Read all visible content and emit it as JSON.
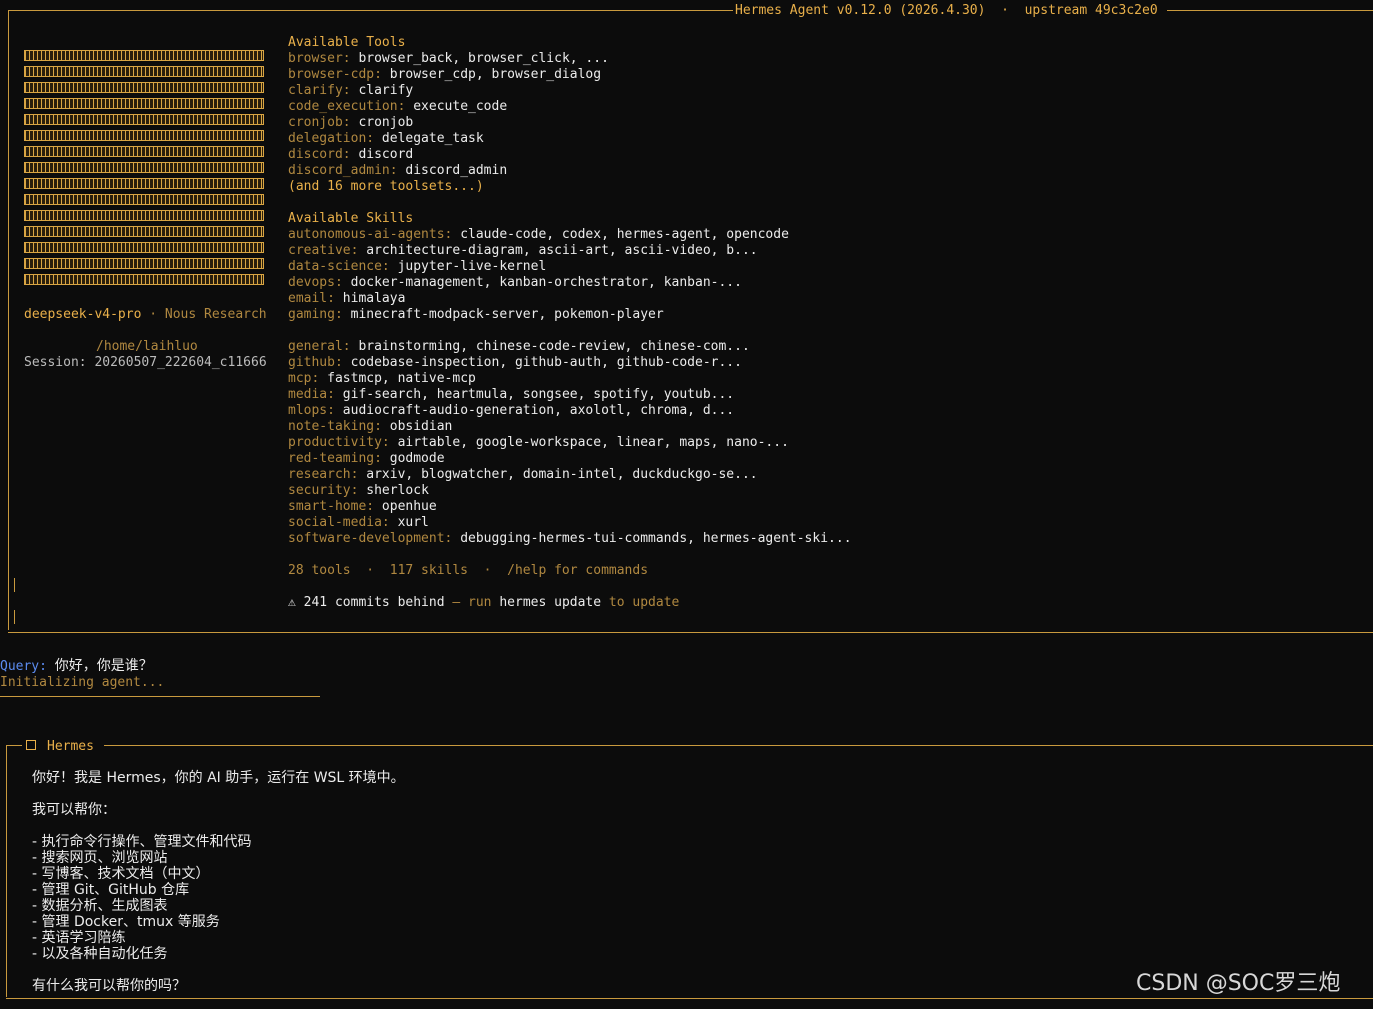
{
  "banner": {
    "title": "Hermes Agent v0.12.0 (2026.4.30)  ·  upstream 49c3c2e0",
    "model": "deepseek-v4-pro",
    "separator": " · ",
    "provider": "Nous Research",
    "cwd": "/home/laihluo",
    "session_label": "Session: ",
    "session_id": "20260507_222604_c11666"
  },
  "tools": {
    "heading": "Available Tools",
    "items": [
      {
        "k": "browser: ",
        "v": "browser_back, browser_click, ..."
      },
      {
        "k": "browser-cdp: ",
        "v": "browser_cdp, browser_dialog"
      },
      {
        "k": "clarify: ",
        "v": "clarify"
      },
      {
        "k": "code_execution: ",
        "v": "execute_code"
      },
      {
        "k": "cronjob: ",
        "v": "cronjob"
      },
      {
        "k": "delegation: ",
        "v": "delegate_task"
      },
      {
        "k": "discord: ",
        "v": "discord"
      },
      {
        "k": "discord_admin: ",
        "v": "discord_admin"
      }
    ],
    "more": "(and 16 more toolsets...)"
  },
  "skills": {
    "heading": "Available Skills",
    "items": [
      {
        "k": "autonomous-ai-agents: ",
        "v": "claude-code, codex, hermes-agent, opencode"
      },
      {
        "k": "creative: ",
        "v": "architecture-diagram, ascii-art, ascii-video, b..."
      },
      {
        "k": "data-science: ",
        "v": "jupyter-live-kernel"
      },
      {
        "k": "devops: ",
        "v": "docker-management, kanban-orchestrator, kanban-..."
      },
      {
        "k": "email: ",
        "v": "himalaya"
      },
      {
        "k": "gaming: ",
        "v": "minecraft-modpack-server, pokemon-player"
      },
      {
        "k": "",
        "v": ""
      },
      {
        "k": "general: ",
        "v": "brainstorming, chinese-code-review, chinese-com..."
      },
      {
        "k": "github: ",
        "v": "codebase-inspection, github-auth, github-code-r..."
      },
      {
        "k": "mcp: ",
        "v": "fastmcp, native-mcp"
      },
      {
        "k": "media: ",
        "v": "gif-search, heartmula, songsee, spotify, youtub..."
      },
      {
        "k": "mlops: ",
        "v": "audiocraft-audio-generation, axolotl, chroma, d..."
      },
      {
        "k": "note-taking: ",
        "v": "obsidian"
      },
      {
        "k": "productivity: ",
        "v": "airtable, google-workspace, linear, maps, nano-..."
      },
      {
        "k": "red-teaming: ",
        "v": "godmode"
      },
      {
        "k": "research: ",
        "v": "arxiv, blogwatcher, domain-intel, duckduckgo-se..."
      },
      {
        "k": "security: ",
        "v": "sherlock"
      },
      {
        "k": "smart-home: ",
        "v": "openhue"
      },
      {
        "k": "social-media: ",
        "v": "xurl"
      },
      {
        "k": "software-development: ",
        "v": "debugging-hermes-tui-commands, hermes-agent-ski..."
      }
    ],
    "summary": "28 tools  ·  117 skills  ·  /help for commands",
    "update_warn_icon": "⚠",
    "update_count": " 241 commits behind ",
    "update_dash": "—",
    "update_run": " run ",
    "update_cmd": "hermes update",
    "update_to": " to update"
  },
  "query": {
    "label": "Query: ",
    "text": "你好，你是谁？",
    "status": "Initializing agent..."
  },
  "response": {
    "title": "Hermes",
    "lines": [
      "你好！我是 Hermes，你的 AI 助手，运行在 WSL 环境中。",
      "",
      "我可以帮你：",
      "",
      "- 执行命令行操作、管理文件和代码",
      "- 搜索网页、浏览网站",
      "- 写博客、技术文档（中文）",
      "- 管理 Git、GitHub 仓库",
      "- 数据分析、生成图表",
      "- 管理 Docker、tmux 等服务",
      "- 英语学习陪练",
      "- 以及各种自动化任务",
      "",
      "有什么我可以帮你的吗？"
    ]
  },
  "watermark": "CSDN @SOC罗三炮",
  "colors": {
    "accent": "#e9b04a",
    "dim": "#b08840",
    "query": "#5c8cf0",
    "background": "#0c0c0c"
  }
}
